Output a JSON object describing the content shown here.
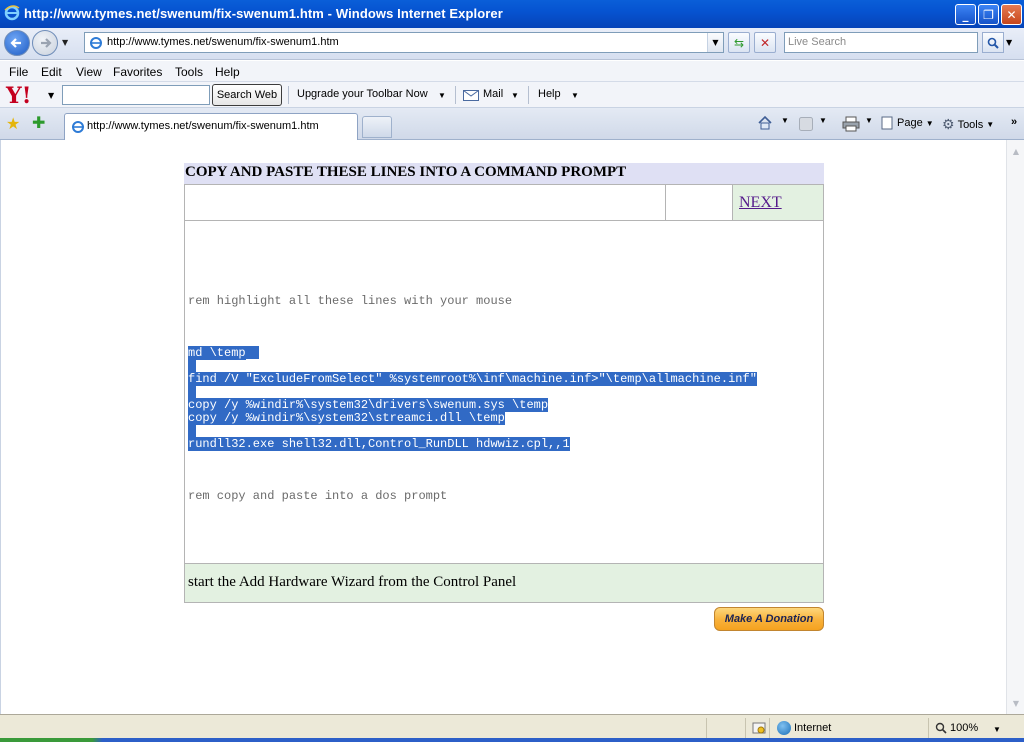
{
  "window": {
    "title": "http://www.tymes.net/swenum/fix-swenum1.htm - Windows Internet Explorer"
  },
  "address_bar": {
    "url": "http://www.tymes.net/swenum/fix-swenum1.htm",
    "search_placeholder": "Live Search"
  },
  "menu": {
    "items": [
      "File",
      "Edit",
      "View",
      "Favorites",
      "Tools",
      "Help"
    ]
  },
  "yahoo_toolbar": {
    "logo": "Y!",
    "search_button": "Search Web",
    "upgrade": "Upgrade your Toolbar Now",
    "mail": "Mail",
    "help": "Help"
  },
  "tabs": {
    "active_label": "http://www.tymes.net/swenum/fix-swenum1.htm"
  },
  "command_bar": {
    "page": "Page",
    "tools": "Tools"
  },
  "page": {
    "header": "COPY AND PASTE THESE LINES INTO A COMMAND PROMPT",
    "next_link": "NEXT",
    "lines": {
      "rem1": "rem highlight all these lines with your mouse",
      "md": "md \\temp",
      "find": "find /V \"ExcludeFromSelect\" %systemroot%\\inf\\machine.inf>\"\\temp\\allmachine.inf\"",
      "copy1": "copy /y %windir%\\system32\\drivers\\swenum.sys \\temp",
      "copy2": "copy /y %windir%\\system32\\streamci.dll \\temp",
      "rundll": "rundll32.exe shell32.dll,Control_RunDLL hdwwiz.cpl,,1",
      "rem2": "rem copy and paste into a dos prompt"
    },
    "footer": "start the Add Hardware Wizard from the Control Panel",
    "donate_button": "Make A Donation"
  },
  "status_bar": {
    "zone": "Internet",
    "zoom": "100%"
  },
  "colors": {
    "selection": "#316ac5",
    "header_bg": "#dfe0f4",
    "footer_bg": "#e3f1e1",
    "title_bar": "#0653d1"
  }
}
